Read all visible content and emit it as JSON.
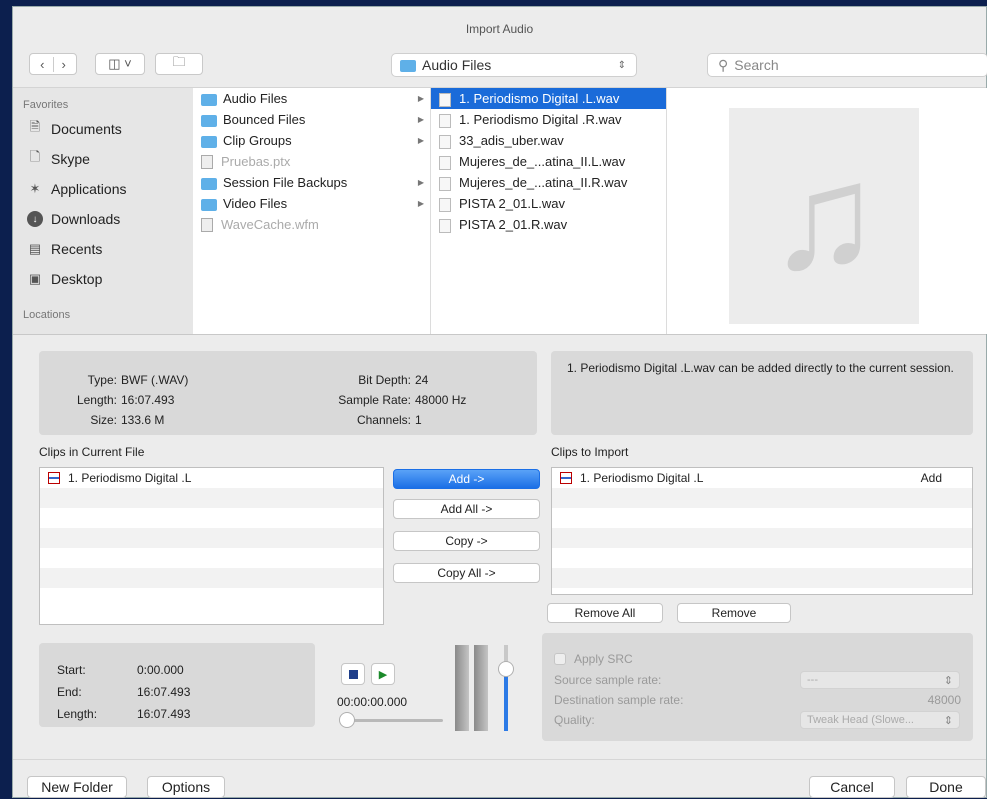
{
  "window": {
    "title": "Import Audio"
  },
  "toolbar": {
    "location": "Audio Files",
    "search_placeholder": "Search"
  },
  "sidebar": {
    "favorites_header": "Favorites",
    "items": [
      {
        "label": "Documents",
        "icon": "documents-icon"
      },
      {
        "label": "Skype",
        "icon": "document-icon"
      },
      {
        "label": "Applications",
        "icon": "applications-icon"
      },
      {
        "label": "Downloads",
        "icon": "downloads-icon"
      },
      {
        "label": "Recents",
        "icon": "recents-icon"
      },
      {
        "label": "Desktop",
        "icon": "desktop-icon"
      }
    ],
    "locations_header": "Locations"
  },
  "column1": [
    {
      "label": "Audio Files",
      "type": "folder"
    },
    {
      "label": "Bounced Files",
      "type": "folder"
    },
    {
      "label": "Clip Groups",
      "type": "folder"
    },
    {
      "label": "Pruebas.ptx",
      "type": "file-dim"
    },
    {
      "label": "Session File Backups",
      "type": "folder"
    },
    {
      "label": "Video Files",
      "type": "folder"
    },
    {
      "label": "WaveCache.wfm",
      "type": "file-dim"
    }
  ],
  "column2": [
    "1. Periodismo Digital .L.wav",
    "1. Periodismo Digital .R.wav",
    "33_adis_uber.wav",
    "Mujeres_de_...atina_II.L.wav",
    "Mujeres_de_...atina_II.R.wav",
    "PISTA 2_01.L.wav",
    "PISTA 2_01.R.wav"
  ],
  "info": {
    "type_label": "Type:",
    "type_value": "BWF (.WAV)",
    "length_label": "Length:",
    "length_value": "16:07.493",
    "size_label": "Size:",
    "size_value": "133.6 M",
    "bitdepth_label": "Bit Depth:",
    "bitdepth_value": "24",
    "samplerate_label": "Sample Rate:",
    "samplerate_value": "48000 Hz",
    "channels_label": "Channels:",
    "channels_value": "1"
  },
  "message": "1. Periodismo Digital .L.wav can be added directly to the current session.",
  "clips_current": {
    "title": "Clips in Current File",
    "items": [
      "1. Periodismo Digital .L"
    ]
  },
  "clips_import": {
    "title": "Clips to Import",
    "items": [
      {
        "name": "1. Periodismo Digital .L",
        "action": "Add"
      }
    ]
  },
  "buttons": {
    "add": "Add ->",
    "add_all": "Add All ->",
    "copy": "Copy ->",
    "copy_all": "Copy All ->",
    "remove_all": "Remove All",
    "remove": "Remove",
    "new_folder": "New Folder",
    "options": "Options",
    "cancel": "Cancel",
    "done": "Done"
  },
  "times": {
    "start_label": "Start:",
    "start": "0:00.000",
    "end_label": "End:",
    "end": "16:07.493",
    "length_label": "Length:",
    "length": "16:07.493"
  },
  "player": {
    "time": "00:00:00.000"
  },
  "src": {
    "apply": "Apply SRC",
    "source_label": "Source sample rate:",
    "source_value": "---",
    "dest_label": "Destination sample rate:",
    "dest_value": "48000",
    "quality_label": "Quality:",
    "quality_value": "Tweak Head (Slowe..."
  }
}
